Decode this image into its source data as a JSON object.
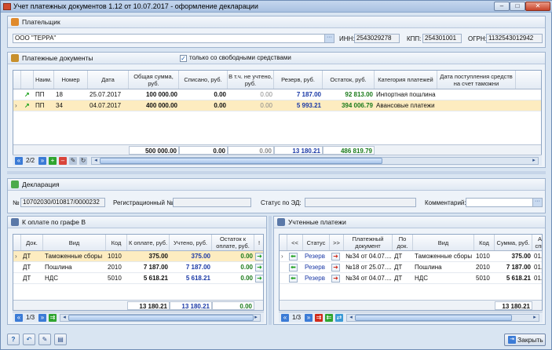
{
  "window": {
    "title": "Учет платежных документов 1.12 от 10.07.2017 - оформление декларации",
    "minimize": "–",
    "maximize": "□",
    "close": "✕"
  },
  "payer": {
    "section": "Плательщик",
    "name": "ООО \"ТЕРРА\"",
    "inn_label": "ИНН:",
    "inn": "2543029278",
    "kpp_label": "КПП:",
    "kpp": "254301001",
    "ogrn_label": "ОГРН:",
    "ogrn": "1132543012942"
  },
  "payments": {
    "section": "Платежные документы",
    "only_free_label": "только со свободными средствами",
    "columns": [
      "Наим.",
      "Номер",
      "Дата",
      "Общая сумма, руб.",
      "Списано, руб.",
      "В т.ч. не учтено, руб.",
      "Резерв, руб.",
      "Остаток, руб.",
      "Категория платежей",
      "Дата поступления средств на счет таможни"
    ],
    "rows": [
      {
        "name": "ПП",
        "number": "18",
        "date": "25.07.2017",
        "total": "100 000.00",
        "written": "0.00",
        "not_counted": "0.00",
        "reserve": "7 187.00",
        "rest": "92 813.00",
        "category": "Инпортная пошлина",
        "arrival": ""
      },
      {
        "name": "ПП",
        "number": "34",
        "date": "04.07.2017",
        "total": "400 000.00",
        "written": "0.00",
        "not_counted": "0.00",
        "reserve": "5 993.21",
        "rest": "394 006.79",
        "category": "Авансовые платежи",
        "arrival": ""
      }
    ],
    "totals": {
      "total": "500 000.00",
      "written": "0.00",
      "not_counted": "0.00",
      "reserve": "13 180.21",
      "rest": "486 819.79"
    },
    "pager": "2/2"
  },
  "declaration": {
    "section": "Декларация",
    "number_label": "№",
    "number": "10702030/010817/0000232",
    "reg_label": "Регистрационный №",
    "reg": "",
    "status_label": "Статус по ЭД:",
    "status": "",
    "comment_label": "Комментарий:",
    "comment": ""
  },
  "to_pay": {
    "section": "К оплате по графе В",
    "columns": [
      "Док.",
      "Вид",
      "Код",
      "К оплате, руб.",
      "Учтено, руб.",
      "Остаток к оплате, руб.",
      "!"
    ],
    "rows": [
      {
        "doc": "ДТ",
        "kind": "Таможенные сборы",
        "code": "1010",
        "to_pay": "375.00",
        "counted": "375.00",
        "rest": "0.00"
      },
      {
        "doc": "ДТ",
        "kind": "Пошлина",
        "code": "2010",
        "to_pay": "7 187.00",
        "counted": "7 187.00",
        "rest": "0.00"
      },
      {
        "doc": "ДТ",
        "kind": "НДС",
        "code": "5010",
        "to_pay": "5 618.21",
        "counted": "5 618.21",
        "rest": "0.00"
      }
    ],
    "totals": {
      "to_pay": "13 180.21",
      "counted": "13 180.21",
      "rest": "0.00"
    },
    "pager": "1/3"
  },
  "counted": {
    "section": "Учтенные платежи",
    "columns": [
      "<<",
      "Статус",
      ">>",
      "Платежный документ",
      "По док.",
      "Вид",
      "Код",
      "Сумма, руб.",
      "А спи"
    ],
    "rows": [
      {
        "status": "Резерв",
        "doc": "№34 от 04.07....",
        "by_doc": "ДТ",
        "kind": "Таможенные сборы",
        "code": "1010",
        "sum": "375.00",
        "extra": "01.0"
      },
      {
        "status": "Резерв",
        "doc": "№18 от 25.07....",
        "by_doc": "ДТ",
        "kind": "Пошлина",
        "code": "2010",
        "sum": "7 187.00",
        "extra": "01.0"
      },
      {
        "status": "Резерв",
        "doc": "№34 от 04.07....",
        "by_doc": "ДТ",
        "kind": "НДС",
        "code": "5010",
        "sum": "5 618.21",
        "extra": "01.0"
      }
    ],
    "totals": {
      "sum": "13 180.21"
    },
    "pager": "1/3"
  },
  "footer": {
    "close_label": "Закрыть"
  }
}
